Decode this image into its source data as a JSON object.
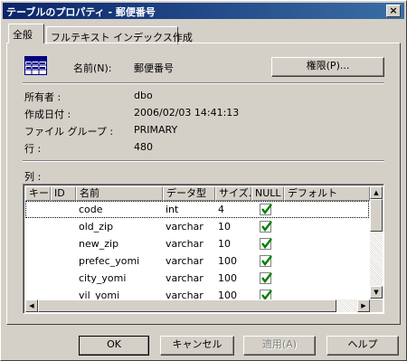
{
  "window": {
    "title": "テーブルのプロパティ - 郵便番号",
    "close_glyph": "×"
  },
  "tabs": [
    {
      "label": "全般",
      "active": true
    },
    {
      "label": "フルテキスト インデックス作成",
      "active": false
    }
  ],
  "general": {
    "table_icon": "table-icon",
    "name_label": "名前(N):",
    "name_value": "郵便番号",
    "permissions_button": "権限(P)...",
    "owner_label": "所有者 :",
    "owner_value": "dbo",
    "created_label": "作成日付 :",
    "created_value": "2006/02/03 14:41:13",
    "filegroup_label": "ファイル グループ :",
    "filegroup_value": "PRIMARY",
    "rows_label": "行 :",
    "rows_value": "480"
  },
  "columns_section": {
    "label": "列 :",
    "headers": [
      "キー",
      "ID",
      "名前",
      "データ型",
      "サイズ...",
      "NULL",
      "デフォルト"
    ],
    "rows": [
      {
        "name": "code",
        "type": "int",
        "size": "4",
        "nullable": true
      },
      {
        "name": "old_zip",
        "type": "varchar",
        "size": "10",
        "nullable": true
      },
      {
        "name": "new_zip",
        "type": "varchar",
        "size": "10",
        "nullable": true
      },
      {
        "name": "prefec_yomi",
        "type": "varchar",
        "size": "100",
        "nullable": true
      },
      {
        "name": "city_yomi",
        "type": "varchar",
        "size": "100",
        "nullable": true
      },
      {
        "name": "vil_yomi",
        "type": "varchar",
        "size": "100",
        "nullable": true
      }
    ]
  },
  "footer": {
    "ok": "OK",
    "cancel": "キャンセル",
    "apply": "適用(A)",
    "help": "ヘルプ"
  },
  "colors": {
    "titlebar": "#0a246a",
    "face": "#d4d0c8",
    "check": "#008000"
  }
}
